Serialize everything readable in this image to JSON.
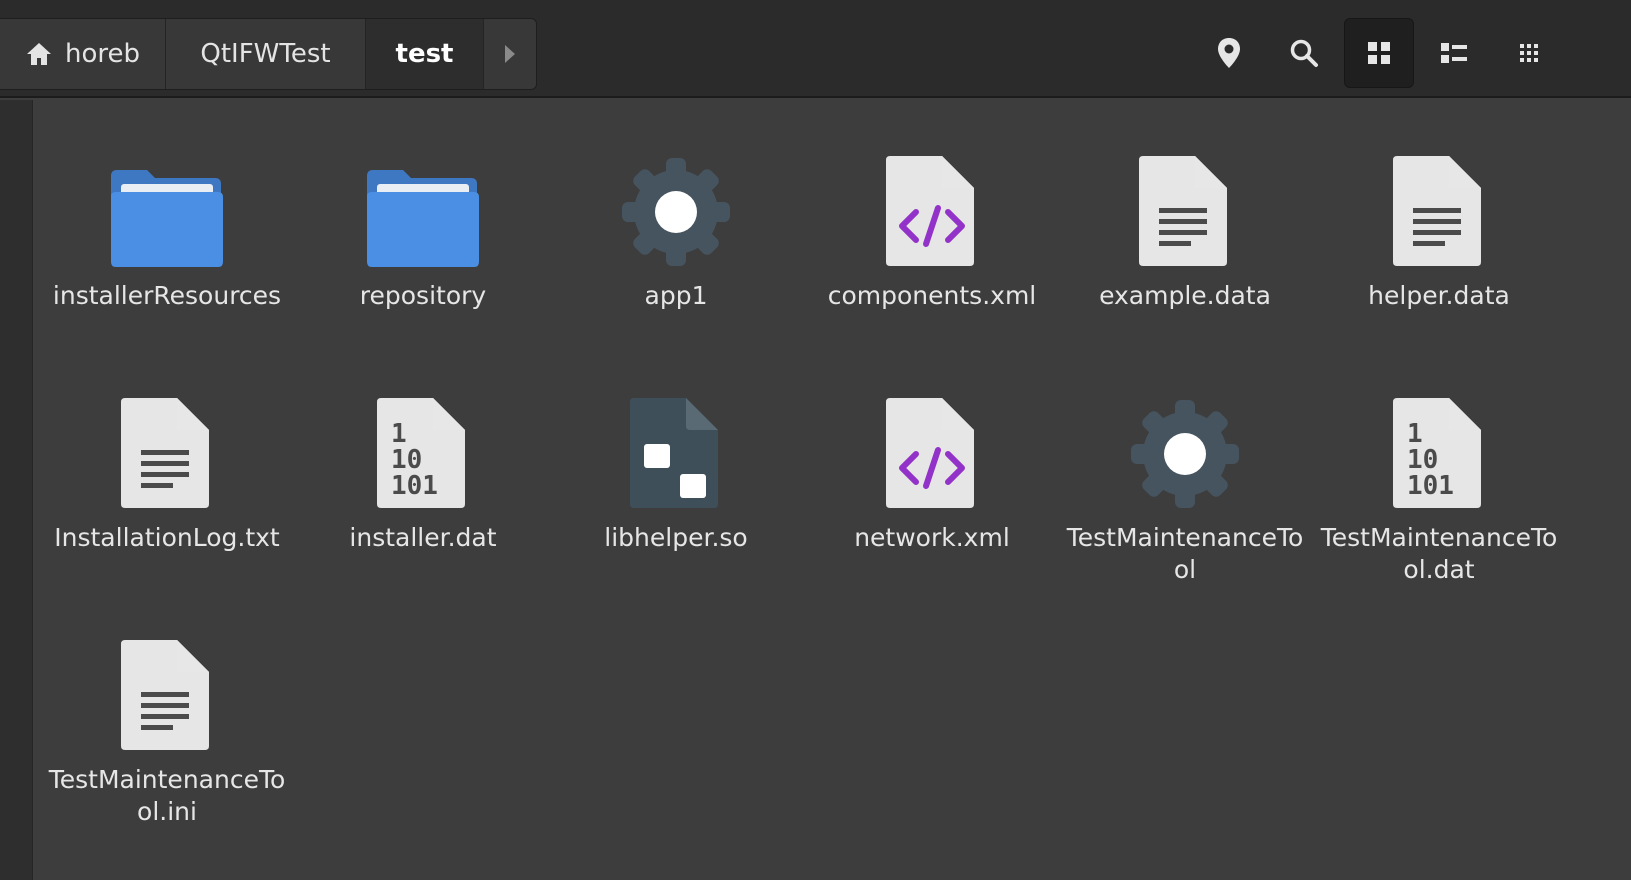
{
  "breadcrumb": {
    "home": "horeb",
    "middle": "QtIFWTest",
    "current": "test"
  },
  "toolbar": {
    "location_icon": "map-pin-icon",
    "search_icon": "search-icon",
    "grid_view_icon": "grid-view-icon",
    "list_view_icon": "list-view-icon",
    "menu_icon": "menu-grid-icon"
  },
  "files": [
    {
      "name": "installerResources",
      "icon": "folder-icon"
    },
    {
      "name": "repository",
      "icon": "folder-icon"
    },
    {
      "name": "app1",
      "icon": "executable-gear-icon"
    },
    {
      "name": "components.xml",
      "icon": "code-file-icon"
    },
    {
      "name": "example.data",
      "icon": "text-file-icon"
    },
    {
      "name": "helper.data",
      "icon": "text-file-icon"
    },
    {
      "name": "InstallationLog.txt",
      "icon": "text-file-icon"
    },
    {
      "name": "installer.dat",
      "icon": "binary-file-icon"
    },
    {
      "name": "libhelper.so",
      "icon": "library-file-icon"
    },
    {
      "name": "network.xml",
      "icon": "code-file-icon"
    },
    {
      "name": "TestMaintenanceTool",
      "icon": "executable-gear-icon"
    },
    {
      "name": "TestMaintenanceTool.dat",
      "icon": "binary-file-icon"
    },
    {
      "name": "TestMaintenanceTool.ini",
      "icon": "text-file-icon"
    }
  ],
  "colors": {
    "folder": "#4a8fe3",
    "page": "#e6e6e6",
    "gear": "#46545f",
    "code": "#9232c9"
  }
}
